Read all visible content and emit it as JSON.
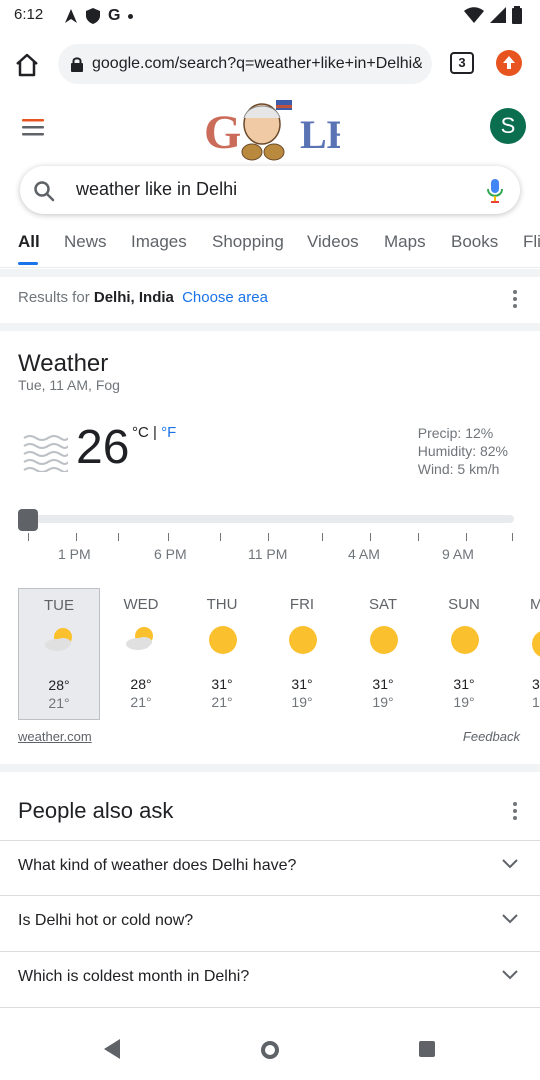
{
  "status_bar": {
    "time": "6:12"
  },
  "browser": {
    "url": "google.com/search?q=weather+like+in+Delhi&oq=w",
    "tab_count": "3"
  },
  "google": {
    "avatar_letter": "S",
    "query": "weather like in Delhi",
    "tabs": [
      "All",
      "News",
      "Images",
      "Shopping",
      "Videos",
      "Maps",
      "Books",
      "Fli"
    ]
  },
  "location": {
    "prefix": "Results for",
    "place": "Delhi, India",
    "choose_area": "Choose area"
  },
  "weather": {
    "title": "Weather",
    "subtitle": "Tue, 11 AM, Fog",
    "temperature": "26",
    "unit_c": "°C",
    "unit_sep": " | ",
    "unit_f": "°F",
    "precip": "Precip: 12%",
    "humidity": "Humidity: 82%",
    "wind": "Wind: 5 km/h",
    "time_labels": [
      "1 PM",
      "6 PM",
      "11 PM",
      "4 AM",
      "9 AM"
    ],
    "days": [
      {
        "name": "TUE",
        "icon": "partly-cloudy-icon",
        "hi": "28°",
        "lo": "21°"
      },
      {
        "name": "WED",
        "icon": "partly-cloudy-icon",
        "hi": "28°",
        "lo": "21°"
      },
      {
        "name": "THU",
        "icon": "sunny-icon",
        "hi": "31°",
        "lo": "21°"
      },
      {
        "name": "FRI",
        "icon": "sunny-icon",
        "hi": "31°",
        "lo": "19°"
      },
      {
        "name": "SAT",
        "icon": "sunny-icon",
        "hi": "31°",
        "lo": "19°"
      },
      {
        "name": "SUN",
        "icon": "sunny-icon",
        "hi": "31°",
        "lo": "19°"
      },
      {
        "name": "M",
        "icon": "sunny-icon",
        "hi": "3",
        "lo": "1"
      }
    ],
    "source": "weather.com",
    "feedback": "Feedback"
  },
  "people_also_ask": {
    "title": "People also ask",
    "questions": [
      "What kind of weather does Delhi have?",
      "Is Delhi hot or cold now?",
      "Which is coldest month in Delhi?"
    ]
  },
  "colors": {
    "accent": "#1a73e8",
    "sun": "#fbc02d",
    "avatar": "#0b6e4f",
    "update": "#e8541f"
  }
}
